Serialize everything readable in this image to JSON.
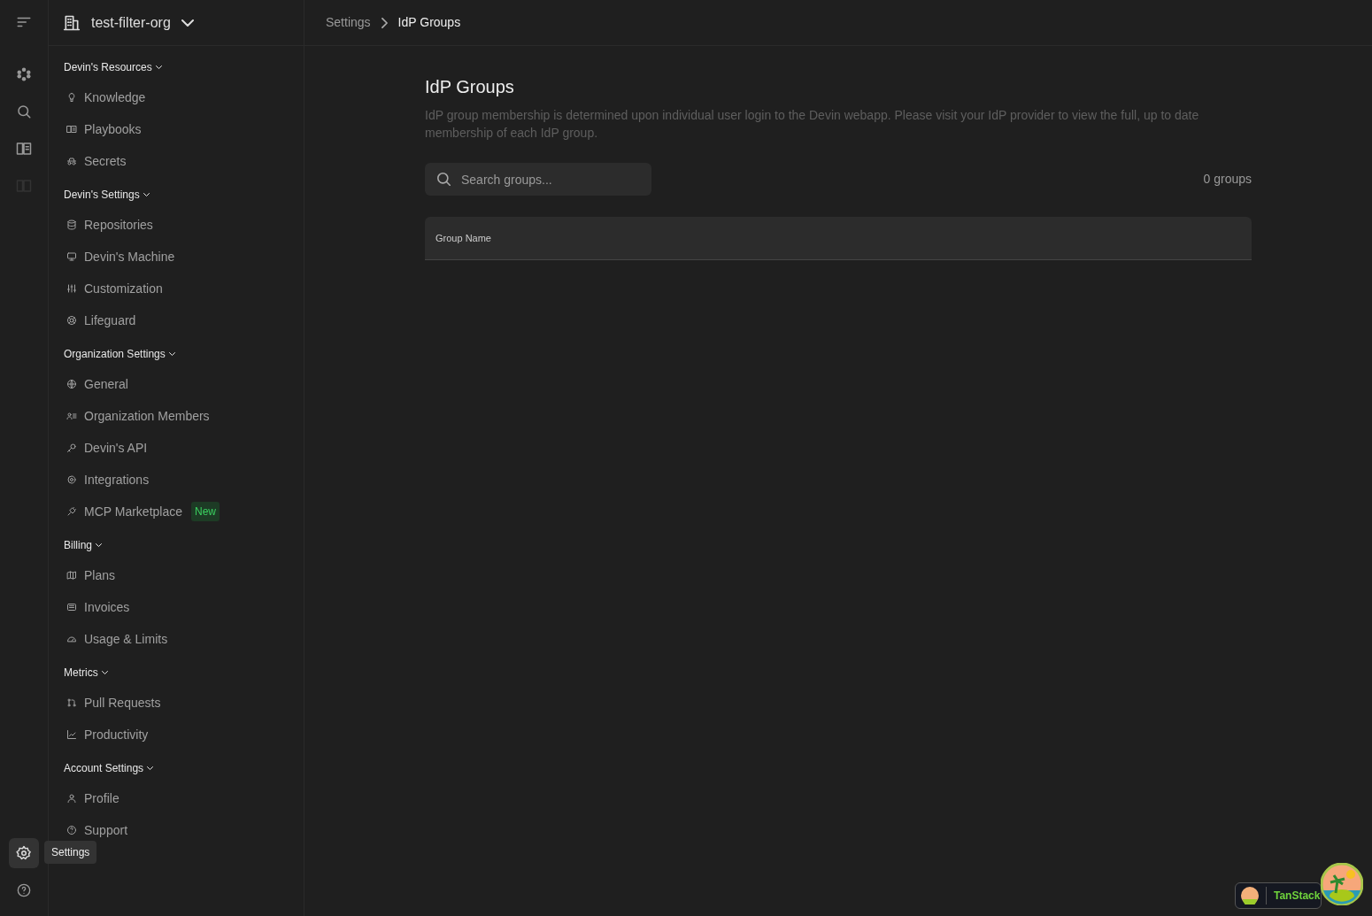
{
  "rail": {
    "settings_active": true,
    "tooltip": "Settings"
  },
  "org": {
    "name": "test-filter-org"
  },
  "sidebar": {
    "sections": [
      {
        "title": "Devin's Resources",
        "expanded": true,
        "items": [
          {
            "label": "Knowledge"
          },
          {
            "label": "Playbooks"
          },
          {
            "label": "Secrets"
          }
        ]
      },
      {
        "title": "Devin's Settings",
        "expanded": true,
        "items": [
          {
            "label": "Repositories"
          },
          {
            "label": "Devin's Machine"
          },
          {
            "label": "Customization"
          },
          {
            "label": "Lifeguard"
          }
        ]
      },
      {
        "title": "Organization Settings",
        "expanded": true,
        "items": [
          {
            "label": "General"
          },
          {
            "label": "Organization Members"
          },
          {
            "label": "Devin's API"
          },
          {
            "label": "Integrations"
          },
          {
            "label": "MCP Marketplace",
            "badge": "New"
          }
        ]
      },
      {
        "title": "Billing",
        "expanded": true,
        "items": [
          {
            "label": "Plans"
          },
          {
            "label": "Invoices"
          },
          {
            "label": "Usage & Limits"
          }
        ]
      },
      {
        "title": "Metrics",
        "expanded": true,
        "items": [
          {
            "label": "Pull Requests"
          },
          {
            "label": "Productivity"
          }
        ]
      },
      {
        "title": "Account Settings",
        "expanded": true,
        "items": [
          {
            "label": "Profile"
          },
          {
            "label": "Support"
          }
        ]
      }
    ]
  },
  "breadcrumb": [
    "Settings",
    "IdP Groups"
  ],
  "page": {
    "title": "IdP Groups",
    "description": "IdP group membership is determined upon individual user login to the Devin webapp. Please visit your IdP provider to view the full, up to date membership of each IdP group.",
    "search": {
      "placeholder": "Search groups..."
    },
    "count": "0 groups"
  },
  "table": {
    "columns": [
      "Group Name"
    ]
  },
  "devtools": {
    "label": "TanStack"
  }
}
